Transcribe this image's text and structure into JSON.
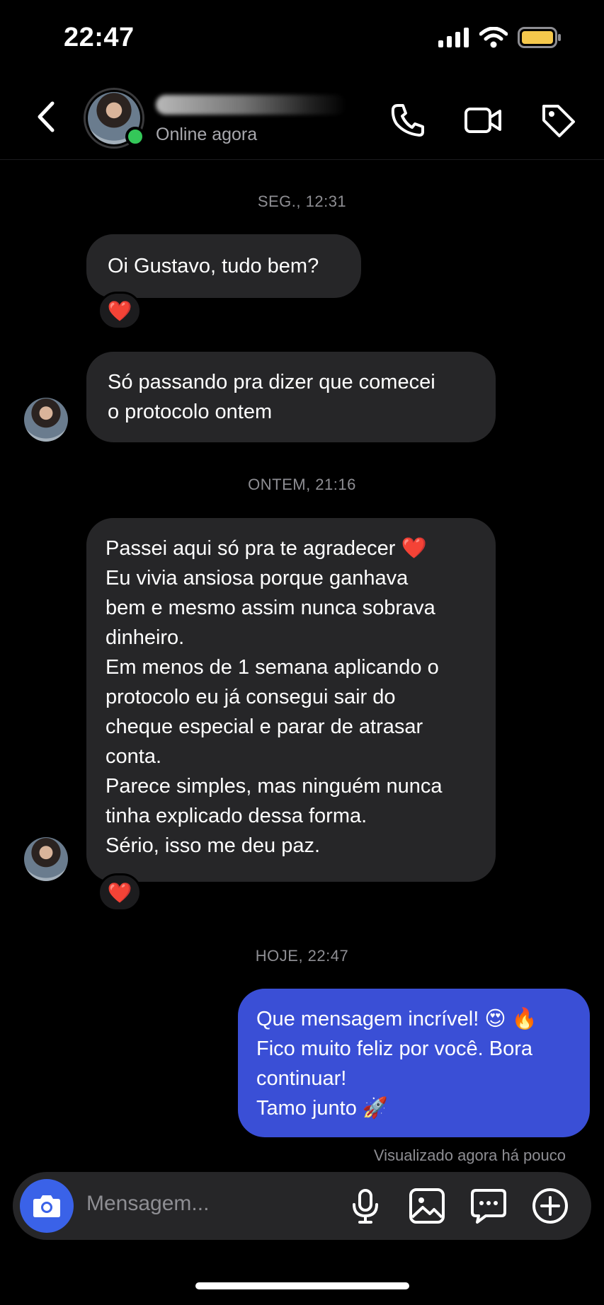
{
  "status_bar": {
    "time": "22:47",
    "icons": [
      "signal-icon",
      "wifi-icon",
      "battery-icon"
    ],
    "battery_color": "#f5c84c"
  },
  "header": {
    "back_icon": "chevron-left-icon",
    "contact_status": "Online agora",
    "actions": [
      "phone-icon",
      "video-camera-icon",
      "tag-icon"
    ],
    "online_color": "#34c759"
  },
  "conversation": {
    "timestamps": [
      "SEG., 12:31",
      "ONTEM, 21:16",
      "HOJE, 22:47"
    ],
    "messages": [
      {
        "text": "Oi Gustavo, tudo bem?",
        "reaction": "❤️"
      },
      {
        "text": "Só passando pra dizer que comecei\no protocolo ontem"
      },
      {
        "text": "Passei aqui só pra te agradecer ❤️\nEu vivia ansiosa porque ganhava\nbem e mesmo assim nunca sobrava\ndinheiro.\nEm menos de 1 semana aplicando o\nprotocolo eu já consegui sair do\ncheque especial e parar de atrasar\nconta.\nParece simples, mas ninguém nunca\ntinha explicado dessa forma.\nSério, isso me deu paz.",
        "reaction": "❤️"
      },
      {
        "text": "Que mensagem incrível! 😍 🔥\nFico muito feliz por você. Bora\ncontinuar!\nTamo junto 🚀"
      }
    ],
    "seen_label": "Visualizado agora há pouco",
    "outgoing_color": "#3a4fd6",
    "incoming_color": "#262628"
  },
  "composer": {
    "placeholder": "Mensagem...",
    "icons": [
      "camera-icon",
      "microphone-icon",
      "image-icon",
      "chat-bubble-icon",
      "plus-circle-icon"
    ]
  }
}
